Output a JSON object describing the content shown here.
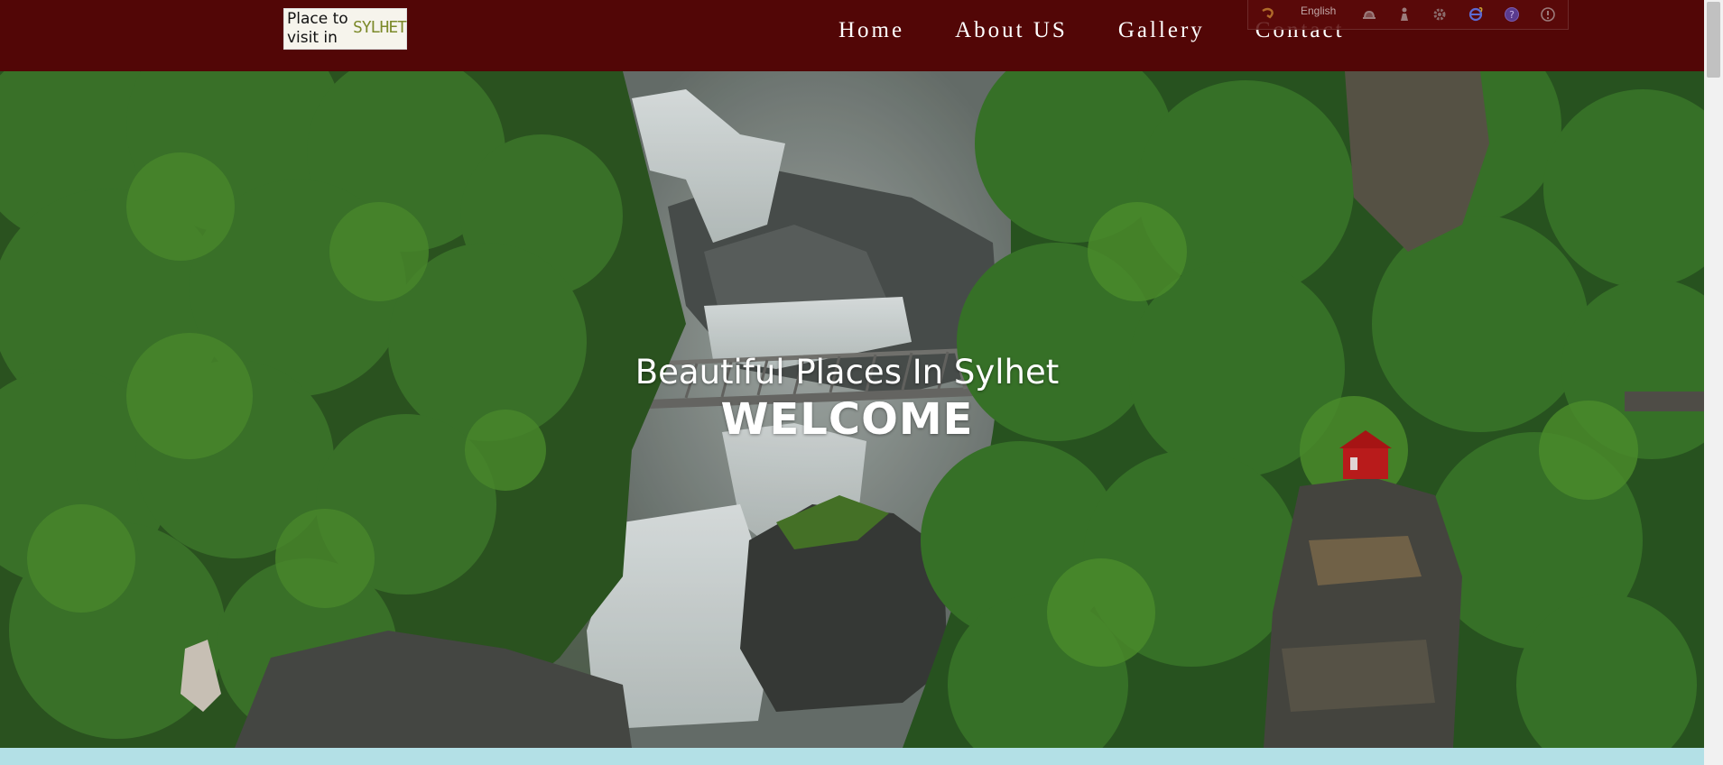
{
  "logo": {
    "line1": "Place to",
    "line2": "visit in",
    "brand": "SYLHET"
  },
  "nav": {
    "home": "Home",
    "about": "About US",
    "gallery": "Gallery",
    "contact": "Contact"
  },
  "extension": {
    "language": "English",
    "icons": [
      "translate-icon",
      "hat-icon",
      "figure-icon",
      "gear-icon",
      "browser-icon",
      "help-icon",
      "info-icon"
    ]
  },
  "hero": {
    "subtitle": "Beautiful Places In Sylhet",
    "title": "WELCOME"
  },
  "colors": {
    "header": "#520606",
    "footer_strip": "#b3e0e6",
    "hero_text": "#ffffff"
  }
}
